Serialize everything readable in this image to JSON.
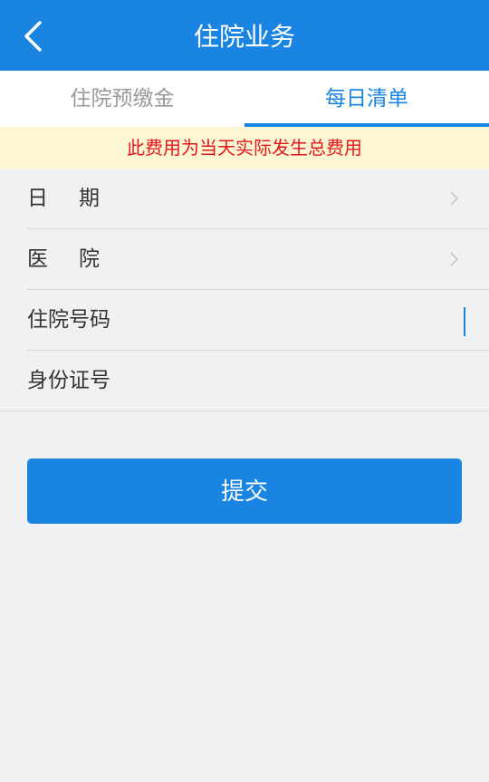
{
  "header": {
    "title": "住院业务",
    "back_icon": "chevron-left-icon"
  },
  "tabs": [
    {
      "label": "住院预缴金",
      "active": false
    },
    {
      "label": "每日清单",
      "active": true
    }
  ],
  "notice": "此费用为当天实际发生总费用",
  "form": {
    "date_label": "日期",
    "hospital_label": "医院",
    "admission_number_label": "住院号码",
    "admission_number_value": "",
    "id_number_label": "身份证号",
    "id_number_value": ""
  },
  "submit_label": "提交",
  "colors": {
    "primary": "#1a84e2",
    "notice_bg": "#fdf7d4",
    "notice_text": "#e4161c",
    "page_bg": "#f0f1f3"
  }
}
